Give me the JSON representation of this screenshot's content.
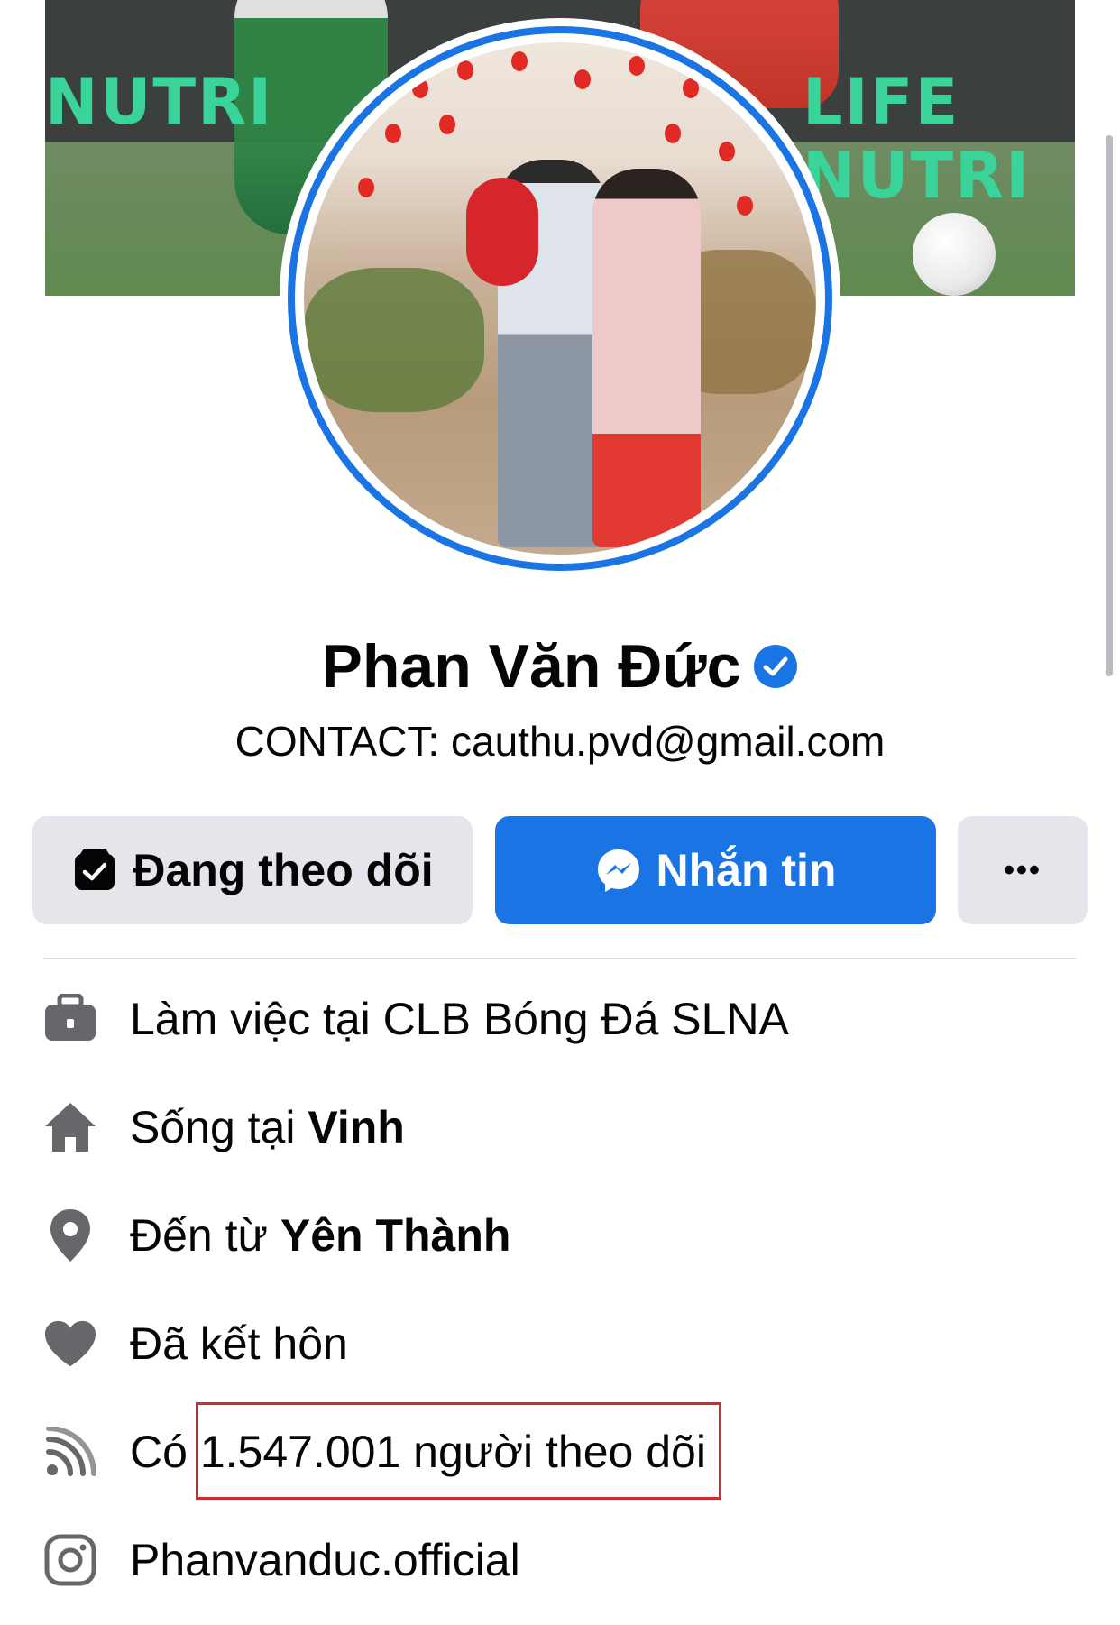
{
  "profile": {
    "name": "Phan Văn Đức",
    "contact": "CONTACT: cauthu.pvd@gmail.com"
  },
  "cover": {
    "banner_left": "NUTRI",
    "banner_right": "LIFE NUTRI"
  },
  "actions": {
    "following_label": "Đang theo dõi",
    "message_label": "Nhắn tin",
    "more_label": "•••"
  },
  "intro": {
    "work": {
      "text": "Làm việc tại CLB Bóng Đá SLNA",
      "icon": "briefcase-icon"
    },
    "lives": {
      "prefix": "Sống tại ",
      "value": "Vinh",
      "icon": "home-icon"
    },
    "from": {
      "prefix": "Đến từ ",
      "value": "Yên Thành",
      "icon": "location-pin-icon"
    },
    "relationship": {
      "text": "Đã kết hôn",
      "icon": "heart-icon"
    },
    "followers": {
      "prefix": "Có ",
      "value": "1.547.001 người theo dõi",
      "icon": "rss-feed-icon"
    },
    "instagram": {
      "text": "Phanvanduc.official",
      "icon": "instagram-icon"
    }
  },
  "colors": {
    "accent": "#1b74e4",
    "button_gray": "#e4e6eb",
    "icon_gray": "#65676b",
    "highlight_box": "#d22a33"
  }
}
